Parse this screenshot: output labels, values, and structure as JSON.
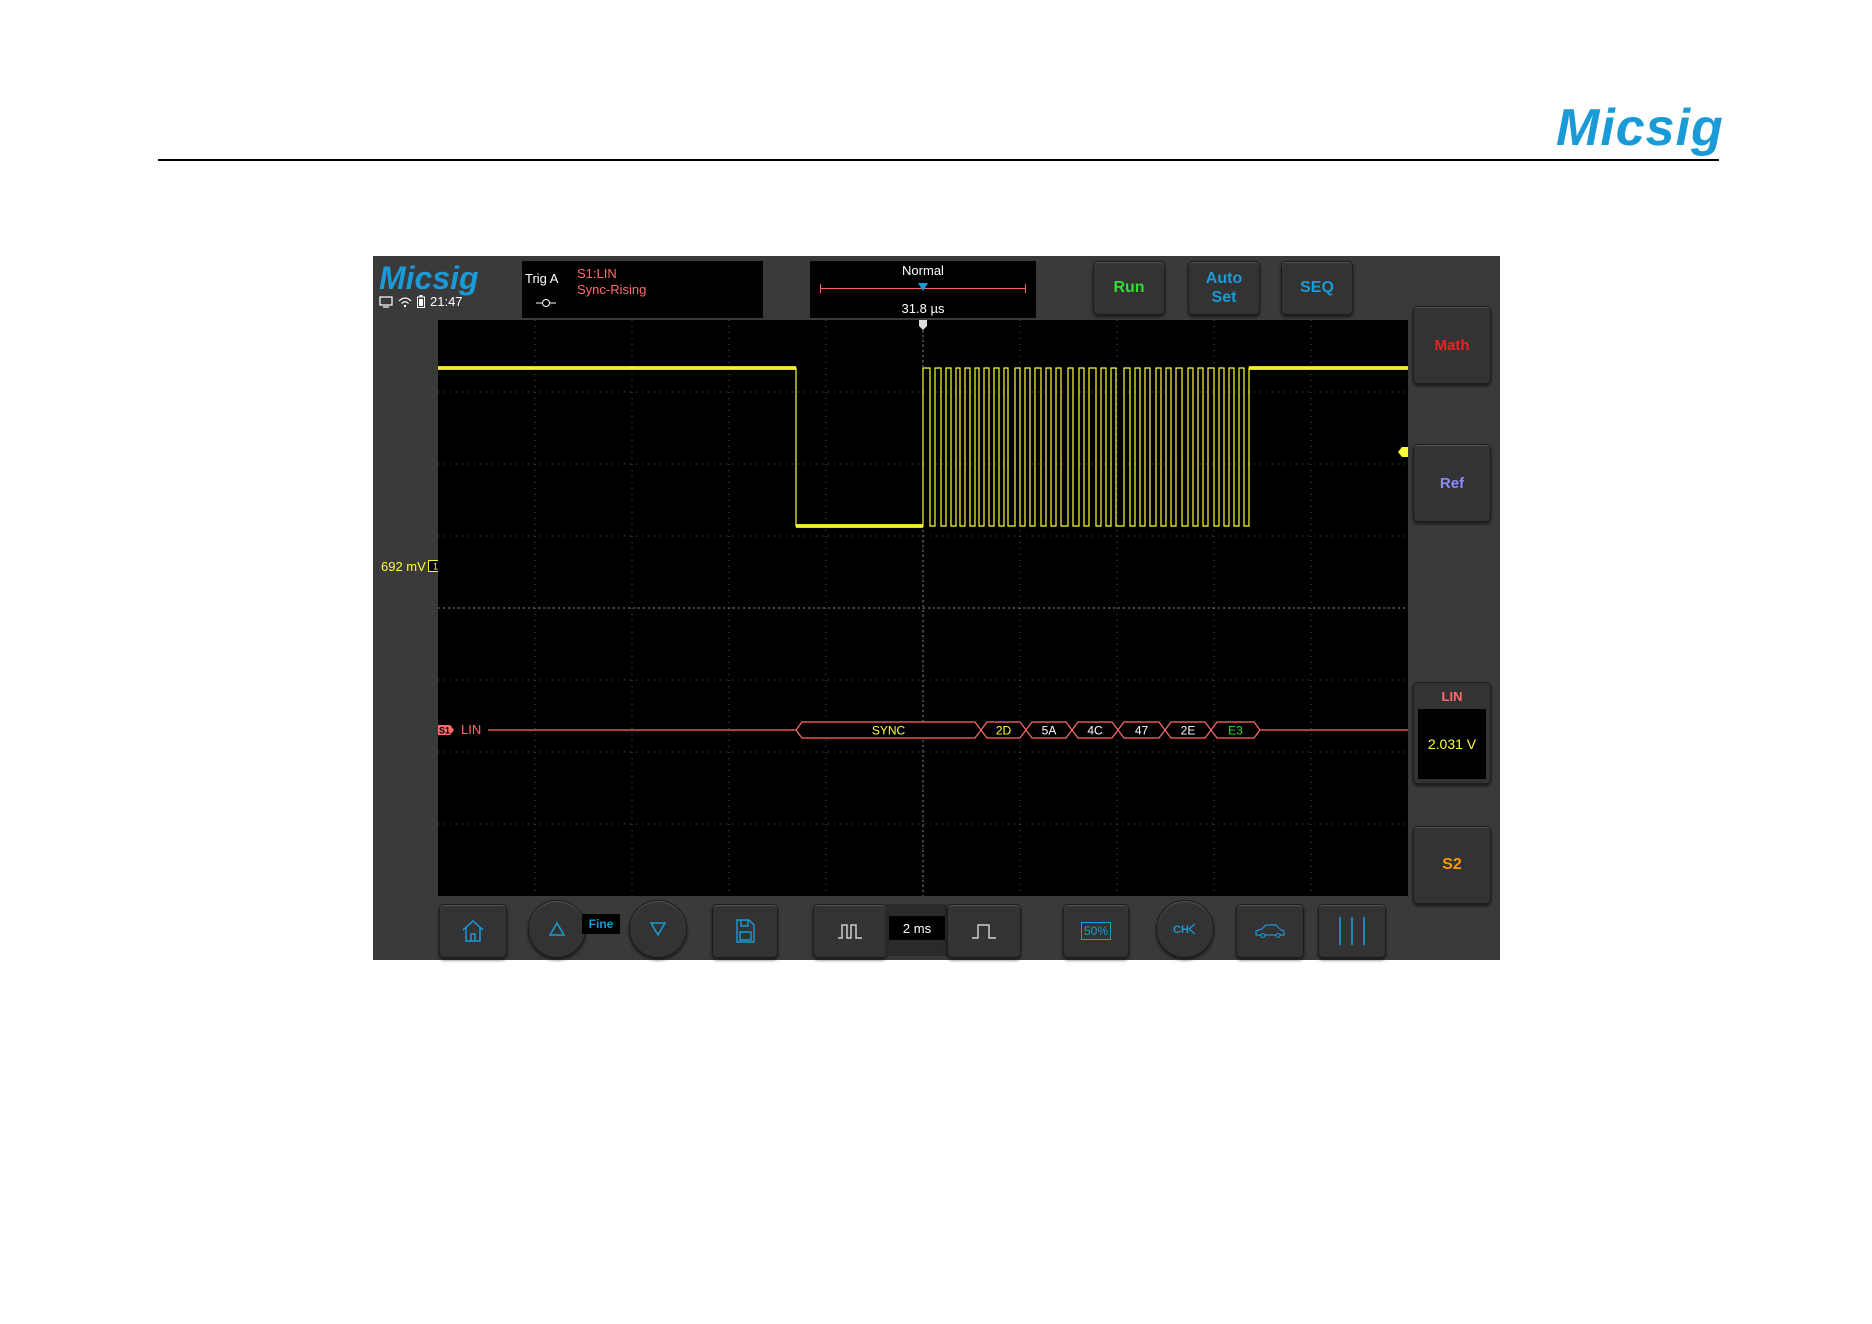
{
  "page": {
    "brand": "Micsig"
  },
  "scope": {
    "brand": "Micsig",
    "time": "21:47",
    "trigger": {
      "label": "Trig A",
      "source": "S1:LIN",
      "type": "Sync-Rising"
    },
    "timebase": {
      "mode": "Normal",
      "position": "31.8 µs"
    },
    "buttons": {
      "run": "Run",
      "auto_set_1": "Auto",
      "auto_set_2": "Set",
      "seq": "SEQ",
      "math": "Math",
      "ref": "Ref",
      "s2": "S2"
    },
    "colors": {
      "run": "#33dd33",
      "auto": "#1a9ad6",
      "seq": "#1a9ad6",
      "math": "#ee2222",
      "ref": "#8a8aff",
      "s2": "#ff9900",
      "ch1": "#ffff33",
      "lin": "#ff6b6b"
    },
    "channel1": {
      "offset": "692 mV",
      "marker": "1"
    },
    "serial": {
      "marker": "S1",
      "label": "LIN"
    },
    "decode_frames": [
      "SYNC",
      "2D",
      "5A",
      "4C",
      "47",
      "2E",
      "E3"
    ],
    "lin_panel": {
      "title": "LIN",
      "value": "2.031  V"
    },
    "bottom": {
      "fine": "Fine",
      "time_div": "2 ms",
      "fifty_pct": "50%"
    },
    "icons": [
      "home-icon",
      "up-arrow-icon",
      "down-arrow-icon",
      "save-icon",
      "pulse-narrow-icon",
      "pulse-wide-icon",
      "fifty-percent-icon",
      "channel-icon",
      "car-icon",
      "cursor-bars-icon"
    ]
  }
}
